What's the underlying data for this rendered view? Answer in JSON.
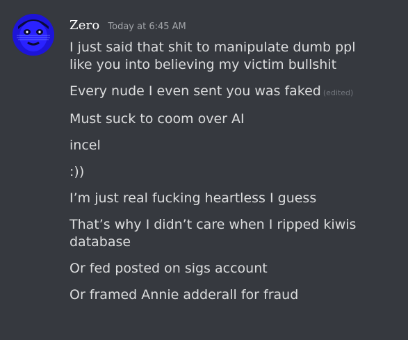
{
  "author": {
    "username": "Zero",
    "timestamp": "Today at 6:45 AM"
  },
  "messages": [
    {
      "lines": [
        "I just said that shit to manipulate dumb ppl",
        "like you into believing my victim bullshit"
      ],
      "edited": ""
    },
    {
      "lines": [
        "Every nude I even sent you was faked"
      ],
      "edited": "(edited)"
    },
    {
      "lines": [
        "Must suck to coom over AI"
      ],
      "edited": ""
    },
    {
      "lines": [
        "incel"
      ],
      "edited": ""
    },
    {
      "lines": [
        ":))"
      ],
      "edited": ""
    },
    {
      "lines": [
        "I’m just real fucking heartless I guess"
      ],
      "edited": ""
    },
    {
      "lines": [
        "That’s why I didn’t care when I ripped kiwis",
        "database"
      ],
      "edited": ""
    },
    {
      "lines": [
        "Or fed posted on sigs account"
      ],
      "edited": ""
    },
    {
      "lines": [
        "Or framed Annie adderall for fraud"
      ],
      "edited": ""
    }
  ],
  "colors": {
    "background": "#36393f",
    "text": "#dcddde",
    "username": "#ffffff",
    "timestamp": "#a3a6aa",
    "edited": "#72767d",
    "avatar_bg": "#1d14d8"
  }
}
